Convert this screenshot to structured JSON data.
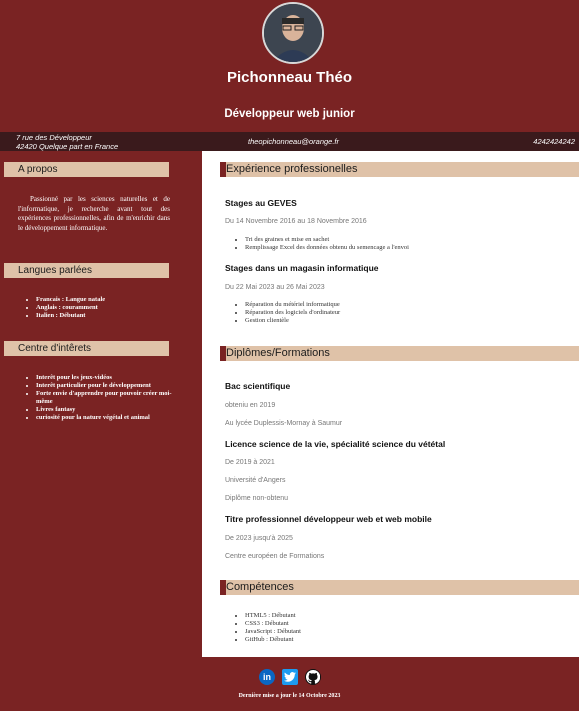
{
  "header": {
    "name": "Pichonneau Théo",
    "role": "Développeur web junior"
  },
  "contact": {
    "address_line1": "7 rue des Développeur",
    "address_line2": "42420 Quelque part en France",
    "email": "theopichonneau@orange.fr",
    "phone": "4242424242"
  },
  "sidebar": {
    "about_title": "A propos",
    "about_text": "Passionné par les sciences naturelles et de l'informatique, je recherche avant tout des expériences professionnelles, afin de m'enrichir dans le développement informatique.",
    "languages_title": "Langues parlées",
    "languages": [
      "Francais : Langue natale",
      "Anglais : couramment",
      "Italien : Débutant"
    ],
    "interests_title": "Centre d'intêrets",
    "interests": [
      "Interêt pour les jeux-vidéos",
      "Interêt particulier pour le développement",
      "Forte envie d'apprendre pour pouvoir créer moi-même",
      "Livres fantasy",
      "curiosité pour la nature végétal et animal"
    ]
  },
  "experience": {
    "title": "Expérience professionelles",
    "jobs": [
      {
        "title": "Stages au GEVES",
        "dates": "Du 14 Novembre 2016 au 18 Novembre 2016",
        "tasks": [
          "Tri des graines et mise en sachet",
          "Remplissage Excel des données obtenu du semencage a l'envoi"
        ]
      },
      {
        "title": "Stages dans un magasin informatique",
        "dates": "Du 22 Mai 2023 au 26 Mai 2023",
        "tasks": [
          "Réparation du métériel informatique",
          "Réparation des logiciels d'ordinateur",
          "Gestion clientèle"
        ]
      }
    ]
  },
  "education": {
    "title": "Diplômes/Formations",
    "items": [
      {
        "title": "Bac scientifique",
        "lines": [
          "obteniu en 2019",
          "Au lycée Duplessis-Mornay à Saumur"
        ]
      },
      {
        "title": "Licence science de la vie, spécialité science du vététal",
        "lines": [
          "De 2019 à 2021",
          "Université d'Angers",
          "Diplôme non-obtenu"
        ]
      },
      {
        "title": "Titre professionnel développeur web et web mobile",
        "lines": [
          "De 2023 jusqu'à 2025",
          "Centre européen de Formations"
        ]
      }
    ]
  },
  "skills": {
    "title": "Compétences",
    "items": [
      "HTML5 : Débutant",
      "CSS3 : Débutant",
      "JavaScript : Débutant",
      "GitHub : Débutant"
    ]
  },
  "footer": {
    "linkedin_glyph": "in",
    "twitter_glyph": "t",
    "updated": "Dernière mise a jour le  14 Octobre 2023"
  },
  "icons": {
    "linkedin": "linkedin-icon",
    "twitter": "twitter-icon",
    "github": "github-icon"
  },
  "colors": {
    "background": "#7a2323",
    "section_header": "#dfc2a8",
    "contact_bar": "#3a1a1c"
  }
}
